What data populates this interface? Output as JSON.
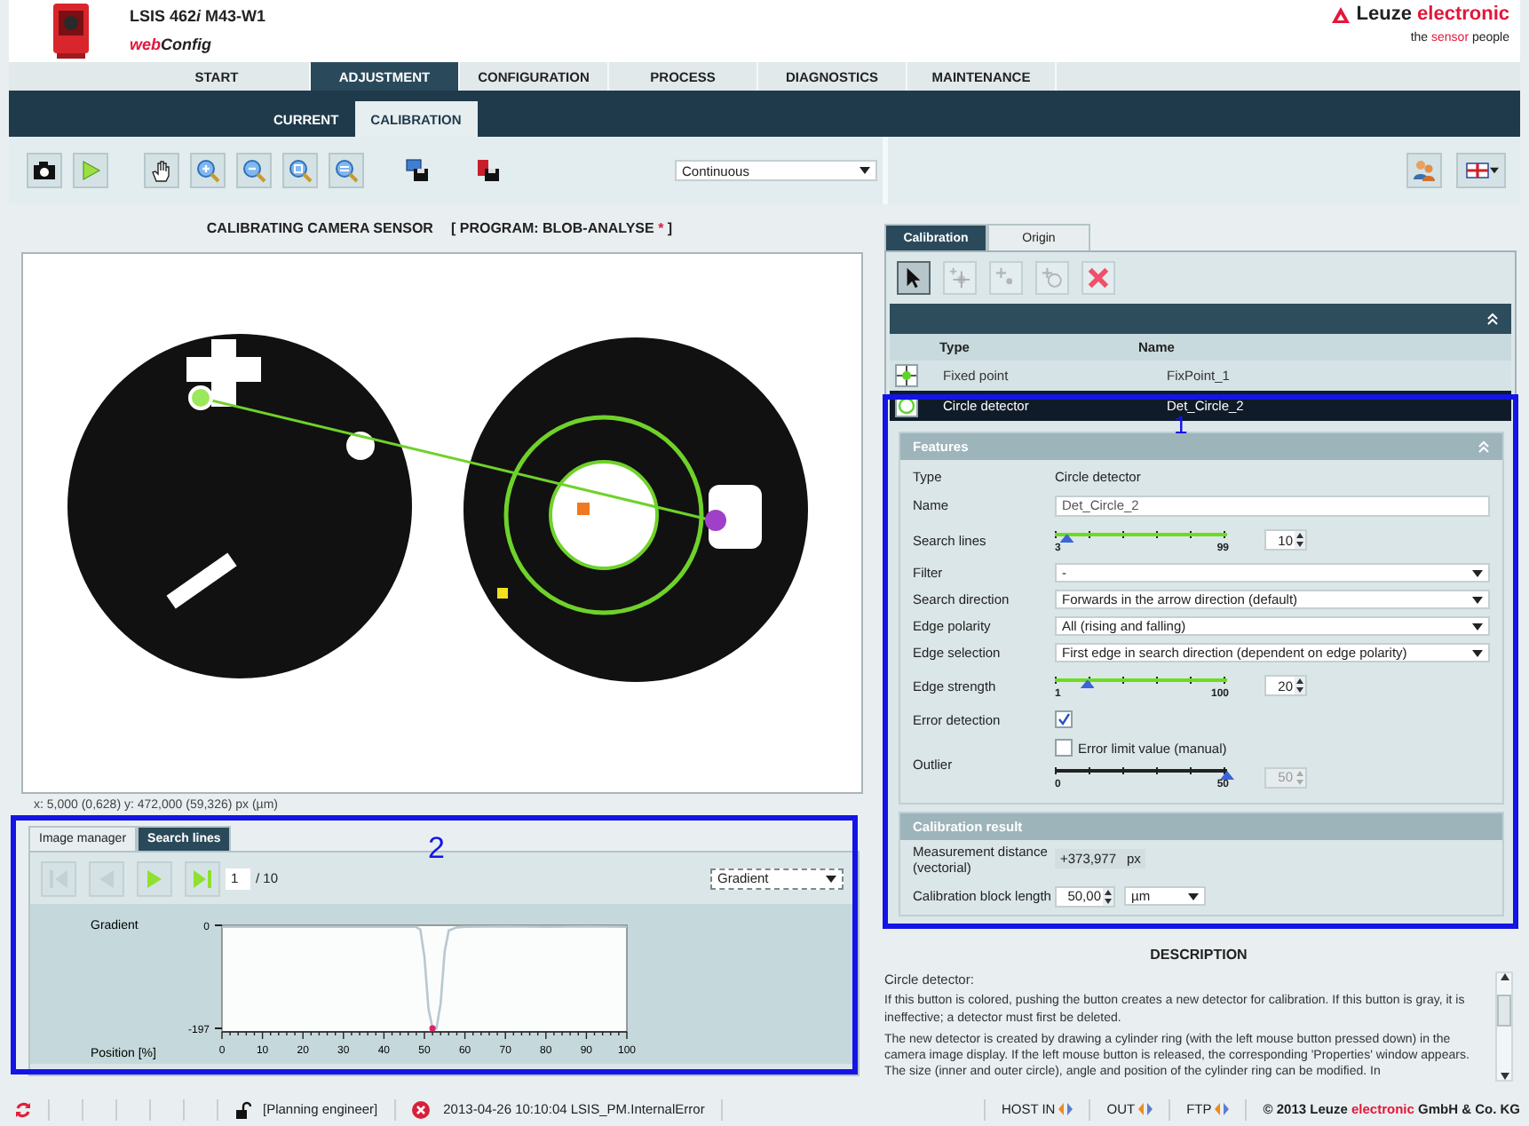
{
  "header": {
    "product_title": [
      {
        "text": "LSIS 462",
        "italic": false
      },
      {
        "text": "i",
        "italic": true
      },
      {
        "text": " M43-W1",
        "italic": false
      }
    ],
    "app_name": [
      {
        "text": "web",
        "accent": true
      },
      {
        "text": "Config",
        "accent": false
      }
    ],
    "brand": [
      {
        "text": "Leuze ",
        "accent": false
      },
      {
        "text": "electronic",
        "accent": true
      }
    ],
    "tagline": [
      {
        "text": "the ",
        "accent": false
      },
      {
        "text": "sensor",
        "accent": true
      },
      {
        "text": " people",
        "accent": false
      }
    ]
  },
  "main_tabs": [
    {
      "label": "START",
      "selected": false
    },
    {
      "label": "ADJUSTMENT",
      "selected": true
    },
    {
      "label": "CONFIGURATION",
      "selected": false
    },
    {
      "label": "PROCESS",
      "selected": false
    },
    {
      "label": "DIAGNOSTICS",
      "selected": false
    },
    {
      "label": "MAINTENANCE",
      "selected": false
    }
  ],
  "sub_tabs": [
    {
      "label": "CURRENT",
      "selected": false
    },
    {
      "label": "CALIBRATION",
      "selected": true
    }
  ],
  "toolbar": {
    "tools": [
      {
        "kind": "camera"
      },
      {
        "kind": "play"
      },
      {
        "kind": "hand"
      },
      {
        "kind": "zoom-in"
      },
      {
        "kind": "zoom-out"
      },
      {
        "kind": "zoom-fit"
      },
      {
        "kind": "zoom-area"
      },
      {
        "kind": "upload"
      },
      {
        "kind": "download"
      }
    ],
    "mode": "Continuous",
    "right_tools": [
      {
        "kind": "users"
      },
      {
        "kind": "flag"
      }
    ]
  },
  "left_panel": {
    "title": "CALIBRATING CAMERA SENSOR",
    "program": [
      {
        "text": "[ PROGRAM: BLOB-ANALYSE ",
        "accent": false
      },
      {
        "text": "*",
        "accent": true
      },
      {
        "text": " ]",
        "accent": false
      }
    ],
    "coordinates": "x: 5,000 (0,628) y: 472,000 (59,326) px (µm)",
    "bottom": {
      "tabs": [
        {
          "label": "Image manager",
          "selected": false
        },
        {
          "label": "Search lines",
          "selected": true
        }
      ],
      "nav": [
        {
          "kind": "first",
          "disabled": true
        },
        {
          "kind": "prev",
          "disabled": true
        },
        {
          "kind": "next",
          "disabled": false
        },
        {
          "kind": "last",
          "disabled": false
        }
      ],
      "page": "1",
      "total": "/ 10",
      "view": "Gradient",
      "chart_data": {
        "type": "line",
        "xlabel": "Position [%]",
        "ylabel": "Gradient",
        "xlim": [
          0,
          100
        ],
        "ylim": [
          -197,
          0
        ],
        "xticks": [
          0,
          10,
          20,
          30,
          40,
          50,
          60,
          70,
          80,
          90,
          100
        ],
        "yticks": [
          0,
          -197
        ],
        "x": [
          0,
          10,
          20,
          30,
          40,
          48,
          49,
          50,
          51,
          52,
          53,
          54,
          55,
          56,
          58,
          60,
          70,
          80,
          90,
          100
        ],
        "series": [
          {
            "color": "#b8c8d0",
            "values": [
              -3,
              -3,
              -3,
              -3,
              -3,
              -3,
              -8,
              -60,
              -160,
              -197,
              -197,
              -150,
              -50,
              -10,
              -4,
              -3,
              -2,
              -3,
              -2,
              -3
            ]
          }
        ]
      }
    }
  },
  "right_panel": {
    "tabs": [
      {
        "label": "Calibration",
        "selected": true
      },
      {
        "label": "Origin",
        "selected": false
      }
    ],
    "tools": [
      {
        "kind": "pointer",
        "selected": true,
        "disabled": false
      },
      {
        "kind": "add-fixed-point",
        "selected": false,
        "disabled": true
      },
      {
        "kind": "add-point",
        "selected": false,
        "disabled": true
      },
      {
        "kind": "add-circle",
        "selected": false,
        "disabled": true
      },
      {
        "kind": "delete",
        "selected": false,
        "disabled": false
      }
    ],
    "table": {
      "columns": [
        "Type",
        "Name"
      ],
      "rows": [
        {
          "kind": "fixed-point",
          "type": "Fixed point",
          "name": "FixPoint_1",
          "selected": false
        },
        {
          "kind": "circle",
          "type": "Circle detector",
          "name": "Det_Circle_2",
          "selected": true
        }
      ]
    },
    "features": {
      "title": "Features",
      "rows": [
        {
          "kind": "text",
          "label": "Type",
          "value": "Circle detector"
        },
        {
          "kind": "field",
          "label": "Name",
          "value": "Det_Circle_2"
        },
        {
          "kind": "slider",
          "label": "Search lines",
          "min": "3",
          "max": "99",
          "level": 0.07,
          "value": "10",
          "disabled": false
        },
        {
          "kind": "select",
          "label": "Filter",
          "value": "-"
        },
        {
          "kind": "select",
          "label": "Search direction",
          "value": "Forwards in the arrow direction (default)"
        },
        {
          "kind": "select",
          "label": "Edge polarity",
          "value": "All (rising and falling)"
        },
        {
          "kind": "select",
          "label": "Edge selection",
          "value": "First edge in search direction (dependent on edge polarity)"
        },
        {
          "kind": "slider",
          "label": "Edge strength",
          "min": "1",
          "max": "100",
          "level": 0.19,
          "value": "20",
          "disabled": false
        },
        {
          "kind": "checkbox",
          "label": "Error detection",
          "checked": true
        },
        {
          "kind": "outlier",
          "label": "Outlier",
          "option": "Error limit value (manual)",
          "checked": false,
          "min": "0",
          "max": "50",
          "level": 1,
          "value": "50",
          "disabled": true
        }
      ]
    },
    "result": {
      "title": "Calibration result",
      "rows": [
        {
          "kind": "reading",
          "label": "Measurement distance (vectorial)",
          "value": "+373,977",
          "unit": "px"
        },
        {
          "kind": "length",
          "label": "Calibration block length",
          "value": "50,00",
          "unit": "µm"
        }
      ]
    }
  },
  "description": {
    "title": "DESCRIPTION",
    "heading": "Circle detector:",
    "paragraphs": [
      "If this button is colored, pushing the button creates a new detector for calibration. If this button is gray, it is ineffective; a detector must first be deleted.",
      "The new detector is created by drawing a cylinder ring (with the left mouse button pressed down) in the camera image display. If the left mouse button is released, the corresponding 'Properties' window appears. The size (inner and outer circle), angle and position of the cylinder ring can be modified. In"
    ]
  },
  "status_bar": {
    "user": "[Planning engineer]",
    "message": "2013-04-26 10:10:04 LSIS_PM.InternalError",
    "signals": [
      {
        "label": "HOST IN"
      },
      {
        "label": "OUT"
      },
      {
        "label": "FTP"
      }
    ],
    "copyright": [
      {
        "text": "© 2013 Leuze ",
        "accent": false
      },
      {
        "text": "electronic",
        "accent": true
      },
      {
        "text": " GmbH & Co. KG",
        "accent": false
      }
    ]
  },
  "callouts": [
    {
      "label": "1"
    },
    {
      "label": "2"
    }
  ]
}
